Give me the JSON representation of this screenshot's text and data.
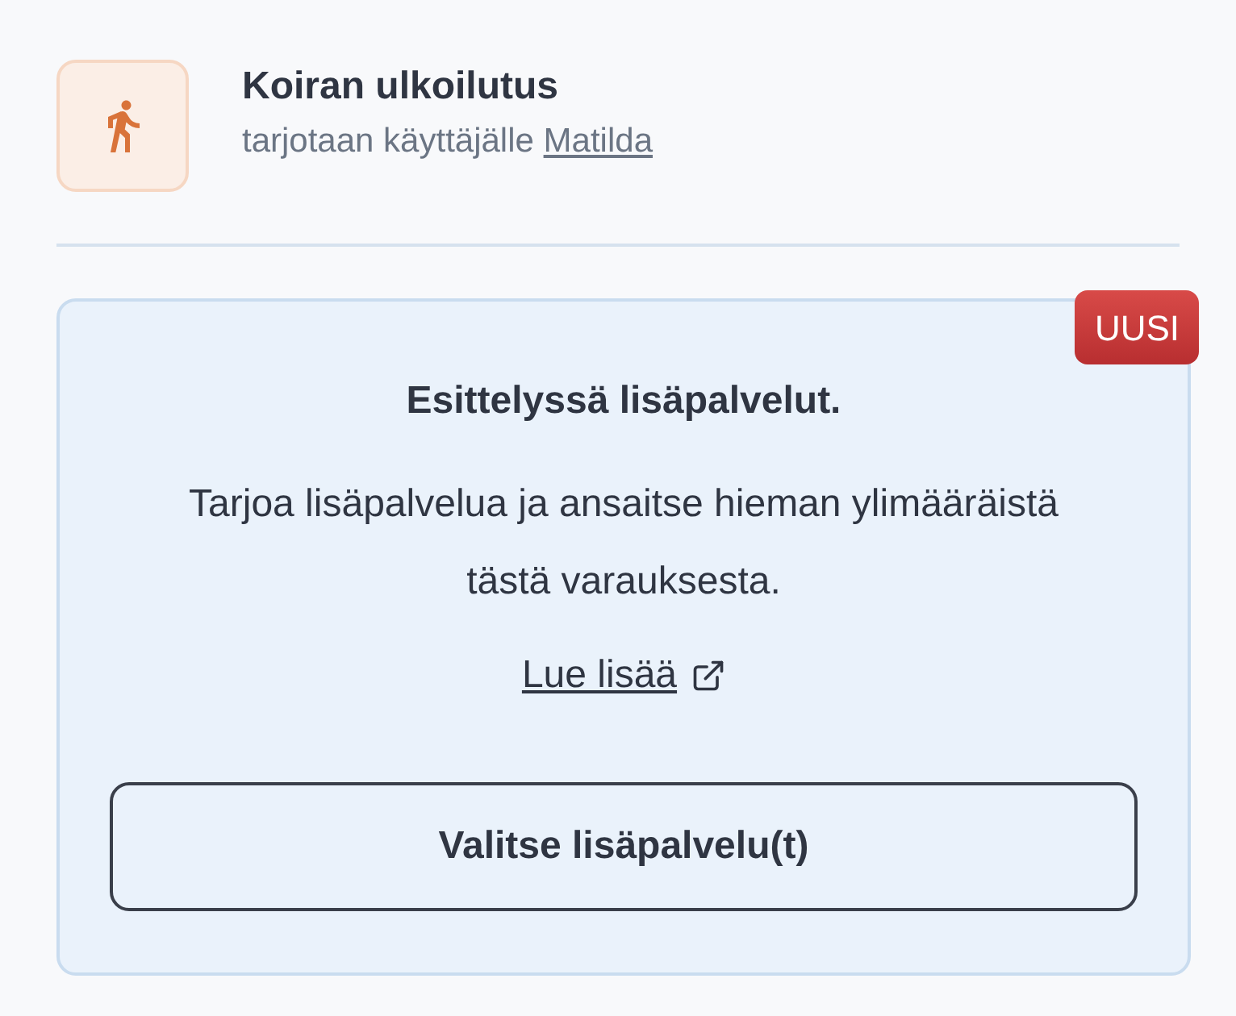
{
  "service": {
    "title": "Koiran ulkoilutus",
    "offered_to": "tarjotaan käyttäjälle",
    "user_link": "Matilda"
  },
  "promo": {
    "badge": "UUSI",
    "heading": "Esittelyssä lisäpalvelut.",
    "body": "Tarjoa lisäpalvelua ja ansaitse hieman ylimääräistä tästä varauksesta.",
    "link": "Lue lisää",
    "button": "Valitse lisäpalvelu(t)"
  }
}
